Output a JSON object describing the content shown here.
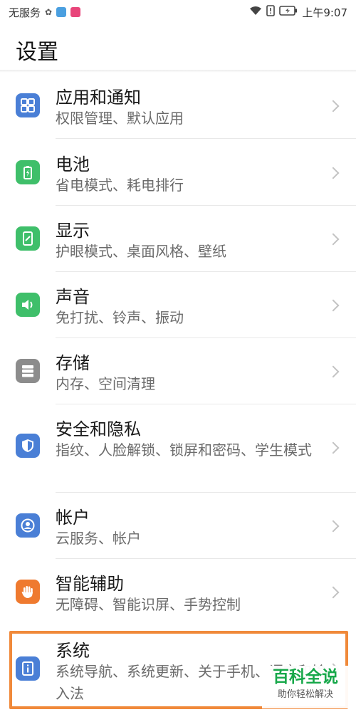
{
  "status_bar": {
    "carrier": "无服务",
    "time": "上午9:07",
    "icons": [
      "huawei-logo-icon",
      "bulb-icon",
      "message-icon",
      "wifi-icon",
      "sim-alert-icon",
      "battery-icon"
    ]
  },
  "page": {
    "title": "设置"
  },
  "items": [
    {
      "title": "应用和通知",
      "subtitle": "权限管理、默认应用",
      "icon": "apps-grid-icon",
      "color": "#4a7fd6"
    },
    {
      "title": "电池",
      "subtitle": "省电模式、耗电排行",
      "icon": "battery-icon",
      "color": "#3fbf6a"
    },
    {
      "title": "显示",
      "subtitle": "护眼模式、桌面风格、壁纸",
      "icon": "display-icon",
      "color": "#3fbf6a"
    },
    {
      "title": "声音",
      "subtitle": "免打扰、铃声、振动",
      "icon": "speaker-icon",
      "color": "#3fbf6a"
    },
    {
      "title": "存储",
      "subtitle": "内存、空间清理",
      "icon": "storage-icon",
      "color": "#8c8c8c"
    },
    {
      "title": "安全和隐私",
      "subtitle": "指纹、人脸解锁、锁屏和密码、学生模式",
      "icon": "shield-icon",
      "color": "#4a7fd6"
    },
    {
      "title": "帐户",
      "subtitle": "云服务、帐户",
      "icon": "account-icon",
      "color": "#4a7fd6"
    },
    {
      "title": "智能辅助",
      "subtitle": "无障碍、智能识屏、手势控制",
      "icon": "hand-icon",
      "color": "#ef7a2f"
    },
    {
      "title": "系统",
      "subtitle": "系统导航、系统更新、关于手机、语言和输入法",
      "icon": "info-icon",
      "color": "#4a7fd6"
    }
  ],
  "watermark": {
    "main": "百科全说",
    "sub": "助你轻松解决"
  },
  "highlight_color": "#f0893a"
}
